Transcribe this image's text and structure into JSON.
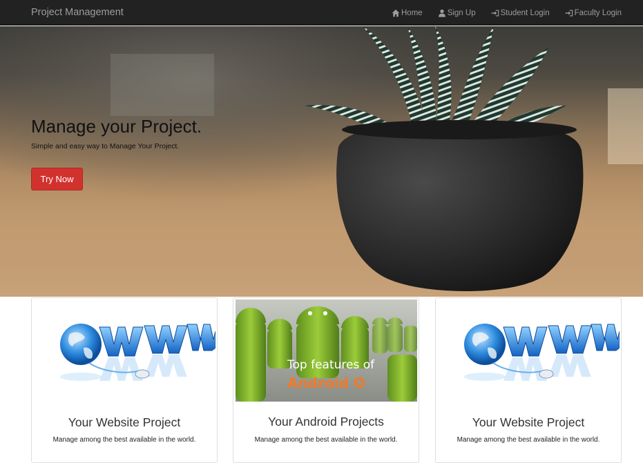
{
  "nav": {
    "brand": "Project Management",
    "links": [
      {
        "label": "Home",
        "icon": "home-icon"
      },
      {
        "label": "Sign Up",
        "icon": "user-icon"
      },
      {
        "label": "Student Login",
        "icon": "login-icon"
      },
      {
        "label": "Faculty Login",
        "icon": "login-icon"
      }
    ]
  },
  "hero": {
    "title": "Manage your Project.",
    "subtitle": "Simple and easy way to Manage Your Project.",
    "button": "Try Now"
  },
  "cards": [
    {
      "title": "Your Website Project",
      "text": "Manage among the best available in the world.",
      "image": "www-globe-image"
    },
    {
      "title": "Your Android Projects",
      "text": "Manage among the best available in the world.",
      "image": "android-image",
      "caption_line1": "Top features of",
      "caption_line2": "Android O"
    },
    {
      "title": "Your Website Project",
      "text": "Manage among the best available in the world.",
      "image": "www-globe-image"
    }
  ],
  "colors": {
    "navbar": "#222222",
    "nav_text": "#9d9d9d",
    "button": "#d2322d",
    "www_blue": "#1e7fd8",
    "android_green": "#8bc34a",
    "android_orange": "#f07a2a"
  }
}
